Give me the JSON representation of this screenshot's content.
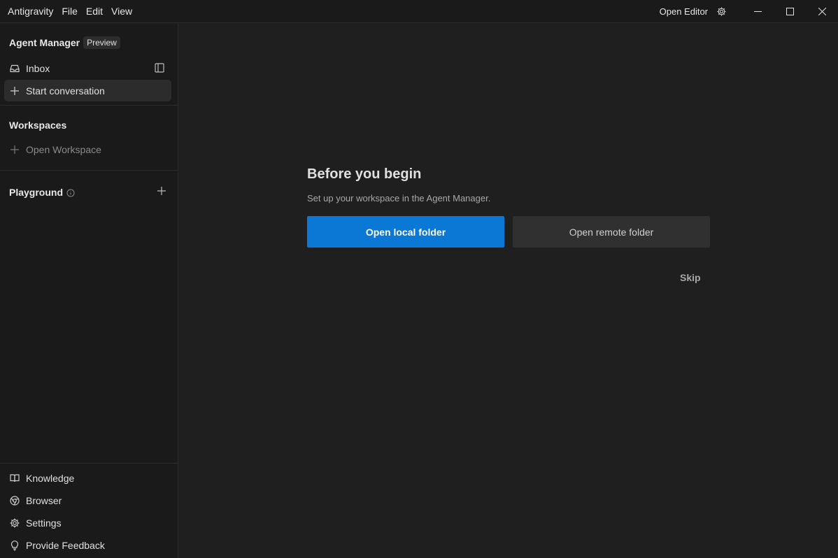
{
  "titlebar": {
    "menu": [
      "Antigravity",
      "File",
      "Edit",
      "View"
    ],
    "open_editor": "Open Editor",
    "icons": {
      "settings": "gear-icon",
      "minimize": "minimize-icon",
      "maximize": "maximize-icon",
      "close": "close-icon"
    }
  },
  "sidebar": {
    "title": "Agent Manager",
    "badge": "Preview",
    "inbox": "Inbox",
    "start_conversation": "Start conversation",
    "workspaces_title": "Workspaces",
    "open_workspace": "Open Workspace",
    "playground_title": "Playground",
    "bottom": {
      "knowledge": "Knowledge",
      "browser": "Browser",
      "settings": "Settings",
      "feedback": "Provide Feedback"
    }
  },
  "main": {
    "title": "Before you begin",
    "subtitle": "Set up your workspace in the Agent Manager.",
    "open_local": "Open local folder",
    "open_remote": "Open remote folder",
    "skip": "Skip"
  },
  "colors": {
    "accent": "#0a78d4",
    "background": "#1f1f1f",
    "sidebar": "#1a1a1a"
  }
}
